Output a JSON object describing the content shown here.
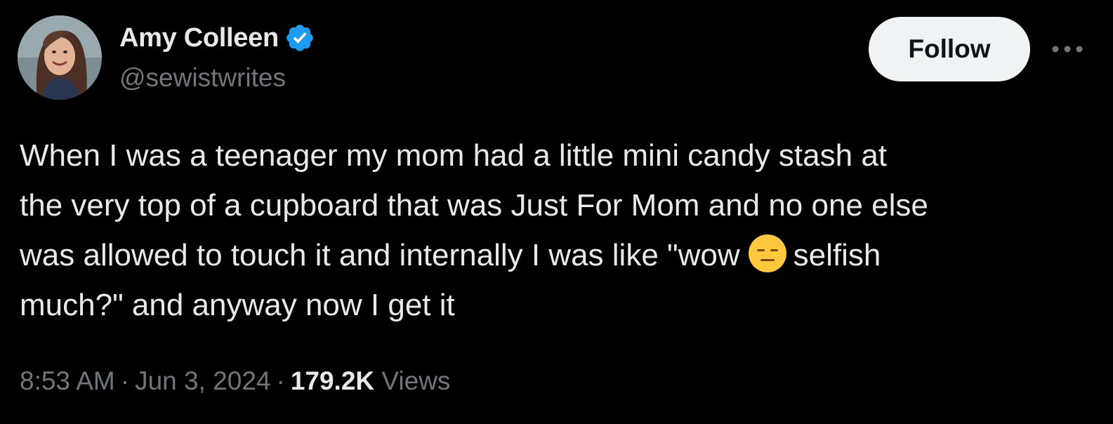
{
  "author": {
    "display_name": "Amy Colleen",
    "handle": "@sewistwrites",
    "verified": true,
    "avatar_icon": "profile-photo",
    "verified_icon": "verified-badge-icon"
  },
  "actions": {
    "follow_label": "Follow",
    "more_icon": "more-options-icon"
  },
  "tweet": {
    "lines": [
      "When I was a teenager my mom had a little mini candy stash at",
      "the very top of a cupboard that was Just For Mom and no one else"
    ],
    "line3_before_emoji": "was allowed to touch it and internally I was like \"wow",
    "emoji_icon": "expressionless-face-emoji",
    "line3_after_emoji": "selfish",
    "line4": "much?\" and anyway now I get it"
  },
  "meta": {
    "time": "8:53 AM",
    "separator": "·",
    "date": "Jun 3, 2024",
    "views_count": "179.2K",
    "views_label": "Views"
  },
  "colors": {
    "background": "#000000",
    "primary_text": "#e7e9ea",
    "secondary_text": "#71767b",
    "verified_blue": "#1d9bf0",
    "follow_button_bg": "#eff3f4",
    "emoji_yellow": "#ffc83d"
  }
}
